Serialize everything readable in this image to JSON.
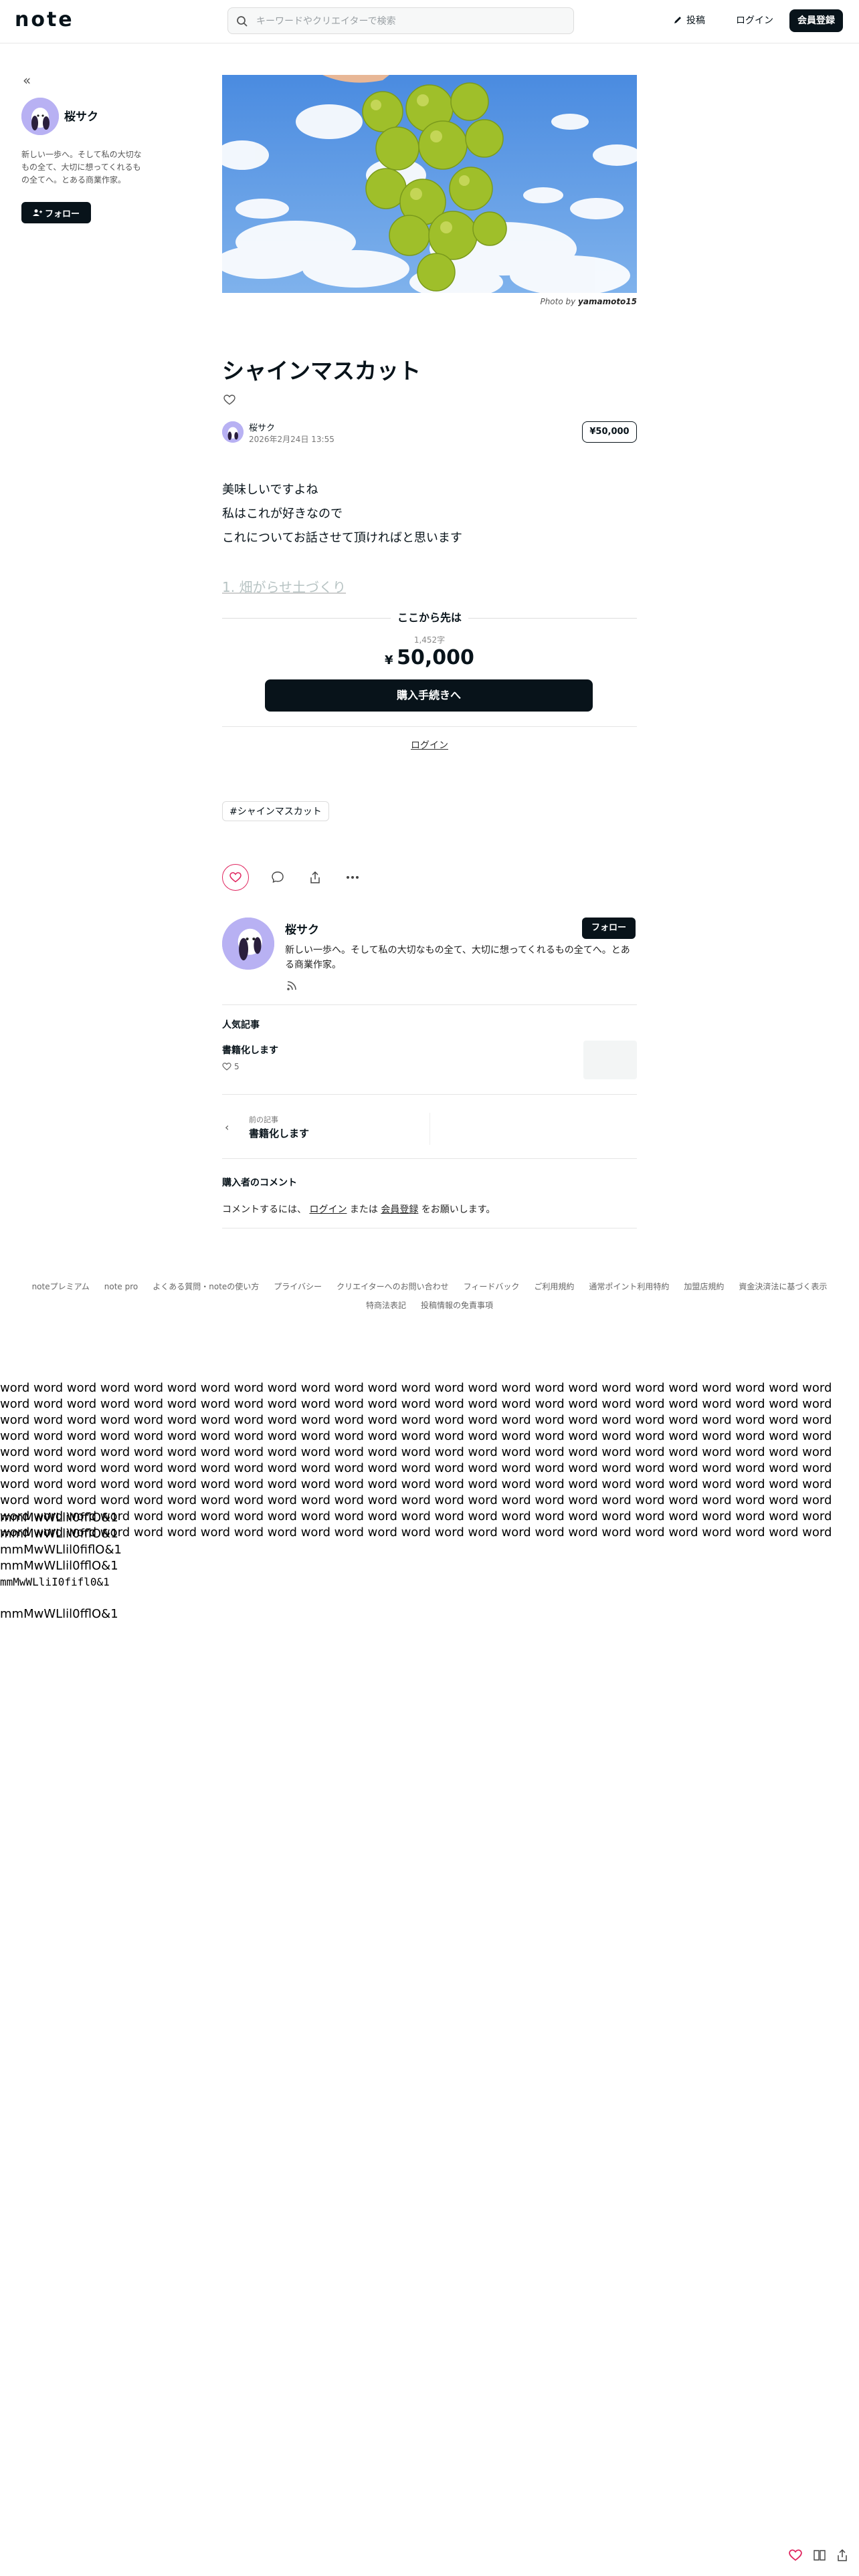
{
  "header": {
    "logo": "note",
    "search_placeholder": "キーワードやクリエイターで検索",
    "post_label": "投稿",
    "login_label": "ログイン",
    "signup_label": "会員登録"
  },
  "sidebar": {
    "author_name": "桜サク",
    "bio": "新しい一歩へ。そして私の大切なもの全て、大切に想ってくれるもの全てへ。とある商業作家。",
    "follow_label": "フォロー"
  },
  "article": {
    "photo_credit_prefix": "Photo by",
    "photo_credit_name": "yamamoto15",
    "title": "シャインマスカット",
    "author_name": "桜サク",
    "date": "2026年2月24日 13:55",
    "price_badge": "¥50,000",
    "paragraphs": [
      "美味しいですよね",
      "私はこれが好きなので",
      "これについてお話させて頂ければと思います"
    ],
    "faded_heading": "1. 畑がらせ土づくり"
  },
  "paywall": {
    "title": "ここから先は",
    "char_count": "1,452字",
    "currency": "¥",
    "amount": "50,000",
    "buy_label": "購入手続きへ",
    "login_label": "ログイン"
  },
  "tags": [
    "#シャインマスカット"
  ],
  "creator": {
    "name": "桜サク",
    "follow_label": "フォロー",
    "bio": "新しい一歩へ。そして私の大切なもの全て、大切に想ってくれるもの全てへ。とある商業作家。"
  },
  "popular": {
    "section_title": "人気記事",
    "item_title": "書籍化します",
    "like_count": "5"
  },
  "prev_article": {
    "label": "前の記事",
    "title": "書籍化します"
  },
  "comments": {
    "section_title": "購入者のコメント",
    "text_before": "コメントするには、",
    "login_link": "ログイン",
    "text_middle": "または",
    "signup_link": "会員登録",
    "text_after": "をお願いします。"
  },
  "footer": {
    "row1": [
      "noteプレミアム",
      "note pro",
      "よくある質問・noteの使い方",
      "プライバシー",
      "クリエイターへのお問い合わせ",
      "フィードバック",
      "ご利用規約",
      "通常ポイント利用特約",
      "加盟店規約",
      "資金決済法に基づく表示"
    ],
    "row2": [
      "特商法表記",
      "投稿情報の免責事項"
    ]
  },
  "test_text": {
    "word_paragraph": "word word word word word word word word word word word word word word word word word word word word word word word word word word word word word word word word word word word word word word word word word word word word word word word word word word word word word word word word word word word word word word word word word word word word word word word word word word word word word word word word word word word word word word word word word word word word word word word word word word word word word word word word word word word word word word word word word word word word word word word word word word word word word word word word word word word word word word word word word word word word word word word word word word word word word word word word word word word word word word word word word word word word word word word word word word word word word word word word word word word word word word word word word word word word word word word word word word word word word word word word word word word word word word word word word word word word word word word word word word word word word word word word word word word word word word word word word word word word word word word word word word word word word word word word word word",
    "lines": [
      "mmMwWLlil0fflO&1",
      "mmMwWLlil0fflO&1",
      "mmMwWLlil0fiflO&1",
      "mmMwWLlil0fflO&1",
      "mmMwWLliI0fifl0&1",
      "mmMwWLlil0fflO&1"
    ]
  }
}
